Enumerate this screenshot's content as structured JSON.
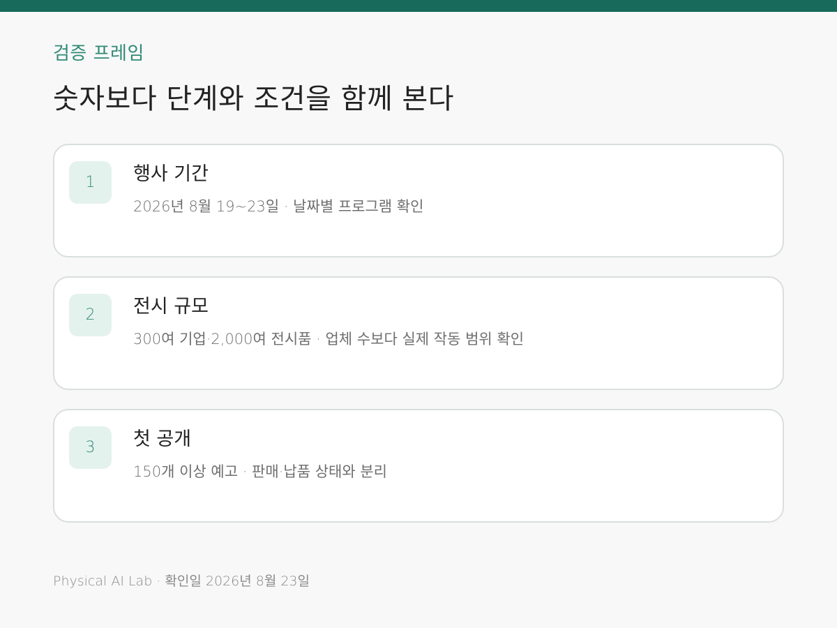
{
  "colors": {
    "accent": "#186a5a",
    "accent_text": "#2f8a74",
    "badge_bg": "#e4f2ee",
    "card_border": "#d9dfdd",
    "background": "#f8f8f8"
  },
  "header": {
    "eyebrow": "검증 프레임",
    "title": "숫자보다 단계와 조건을 함께 본다"
  },
  "items": [
    {
      "number": "1",
      "title": "행사 기간",
      "description": "2026년 8월 19~23일 · 날짜별 프로그램 확인"
    },
    {
      "number": "2",
      "title": "전시 규모",
      "description": "300여 기업·2,000여 전시품 · 업체 수보다 실제 작동 범위 확인"
    },
    {
      "number": "3",
      "title": "첫 공개",
      "description": "150개 이상 예고 · 판매·납품 상태와 분리"
    }
  ],
  "footer": {
    "text": "Physical AI Lab · 확인일 2026년 8월 23일"
  }
}
